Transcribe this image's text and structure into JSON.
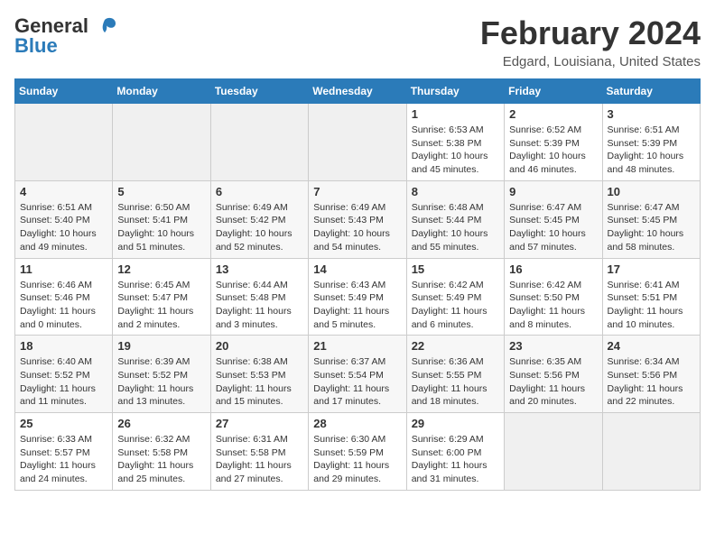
{
  "header": {
    "logo_general": "General",
    "logo_blue": "Blue",
    "month": "February 2024",
    "location": "Edgard, Louisiana, United States"
  },
  "days_of_week": [
    "Sunday",
    "Monday",
    "Tuesday",
    "Wednesday",
    "Thursday",
    "Friday",
    "Saturday"
  ],
  "weeks": [
    [
      {
        "day": "",
        "empty": true
      },
      {
        "day": "",
        "empty": true
      },
      {
        "day": "",
        "empty": true
      },
      {
        "day": "",
        "empty": true
      },
      {
        "day": "1",
        "sunrise": "Sunrise: 6:53 AM",
        "sunset": "Sunset: 5:38 PM",
        "daylight": "Daylight: 10 hours and 45 minutes."
      },
      {
        "day": "2",
        "sunrise": "Sunrise: 6:52 AM",
        "sunset": "Sunset: 5:39 PM",
        "daylight": "Daylight: 10 hours and 46 minutes."
      },
      {
        "day": "3",
        "sunrise": "Sunrise: 6:51 AM",
        "sunset": "Sunset: 5:39 PM",
        "daylight": "Daylight: 10 hours and 48 minutes."
      }
    ],
    [
      {
        "day": "4",
        "sunrise": "Sunrise: 6:51 AM",
        "sunset": "Sunset: 5:40 PM",
        "daylight": "Daylight: 10 hours and 49 minutes."
      },
      {
        "day": "5",
        "sunrise": "Sunrise: 6:50 AM",
        "sunset": "Sunset: 5:41 PM",
        "daylight": "Daylight: 10 hours and 51 minutes."
      },
      {
        "day": "6",
        "sunrise": "Sunrise: 6:49 AM",
        "sunset": "Sunset: 5:42 PM",
        "daylight": "Daylight: 10 hours and 52 minutes."
      },
      {
        "day": "7",
        "sunrise": "Sunrise: 6:49 AM",
        "sunset": "Sunset: 5:43 PM",
        "daylight": "Daylight: 10 hours and 54 minutes."
      },
      {
        "day": "8",
        "sunrise": "Sunrise: 6:48 AM",
        "sunset": "Sunset: 5:44 PM",
        "daylight": "Daylight: 10 hours and 55 minutes."
      },
      {
        "day": "9",
        "sunrise": "Sunrise: 6:47 AM",
        "sunset": "Sunset: 5:45 PM",
        "daylight": "Daylight: 10 hours and 57 minutes."
      },
      {
        "day": "10",
        "sunrise": "Sunrise: 6:47 AM",
        "sunset": "Sunset: 5:45 PM",
        "daylight": "Daylight: 10 hours and 58 minutes."
      }
    ],
    [
      {
        "day": "11",
        "sunrise": "Sunrise: 6:46 AM",
        "sunset": "Sunset: 5:46 PM",
        "daylight": "Daylight: 11 hours and 0 minutes."
      },
      {
        "day": "12",
        "sunrise": "Sunrise: 6:45 AM",
        "sunset": "Sunset: 5:47 PM",
        "daylight": "Daylight: 11 hours and 2 minutes."
      },
      {
        "day": "13",
        "sunrise": "Sunrise: 6:44 AM",
        "sunset": "Sunset: 5:48 PM",
        "daylight": "Daylight: 11 hours and 3 minutes."
      },
      {
        "day": "14",
        "sunrise": "Sunrise: 6:43 AM",
        "sunset": "Sunset: 5:49 PM",
        "daylight": "Daylight: 11 hours and 5 minutes."
      },
      {
        "day": "15",
        "sunrise": "Sunrise: 6:42 AM",
        "sunset": "Sunset: 5:49 PM",
        "daylight": "Daylight: 11 hours and 6 minutes."
      },
      {
        "day": "16",
        "sunrise": "Sunrise: 6:42 AM",
        "sunset": "Sunset: 5:50 PM",
        "daylight": "Daylight: 11 hours and 8 minutes."
      },
      {
        "day": "17",
        "sunrise": "Sunrise: 6:41 AM",
        "sunset": "Sunset: 5:51 PM",
        "daylight": "Daylight: 11 hours and 10 minutes."
      }
    ],
    [
      {
        "day": "18",
        "sunrise": "Sunrise: 6:40 AM",
        "sunset": "Sunset: 5:52 PM",
        "daylight": "Daylight: 11 hours and 11 minutes."
      },
      {
        "day": "19",
        "sunrise": "Sunrise: 6:39 AM",
        "sunset": "Sunset: 5:52 PM",
        "daylight": "Daylight: 11 hours and 13 minutes."
      },
      {
        "day": "20",
        "sunrise": "Sunrise: 6:38 AM",
        "sunset": "Sunset: 5:53 PM",
        "daylight": "Daylight: 11 hours and 15 minutes."
      },
      {
        "day": "21",
        "sunrise": "Sunrise: 6:37 AM",
        "sunset": "Sunset: 5:54 PM",
        "daylight": "Daylight: 11 hours and 17 minutes."
      },
      {
        "day": "22",
        "sunrise": "Sunrise: 6:36 AM",
        "sunset": "Sunset: 5:55 PM",
        "daylight": "Daylight: 11 hours and 18 minutes."
      },
      {
        "day": "23",
        "sunrise": "Sunrise: 6:35 AM",
        "sunset": "Sunset: 5:56 PM",
        "daylight": "Daylight: 11 hours and 20 minutes."
      },
      {
        "day": "24",
        "sunrise": "Sunrise: 6:34 AM",
        "sunset": "Sunset: 5:56 PM",
        "daylight": "Daylight: 11 hours and 22 minutes."
      }
    ],
    [
      {
        "day": "25",
        "sunrise": "Sunrise: 6:33 AM",
        "sunset": "Sunset: 5:57 PM",
        "daylight": "Daylight: 11 hours and 24 minutes."
      },
      {
        "day": "26",
        "sunrise": "Sunrise: 6:32 AM",
        "sunset": "Sunset: 5:58 PM",
        "daylight": "Daylight: 11 hours and 25 minutes."
      },
      {
        "day": "27",
        "sunrise": "Sunrise: 6:31 AM",
        "sunset": "Sunset: 5:58 PM",
        "daylight": "Daylight: 11 hours and 27 minutes."
      },
      {
        "day": "28",
        "sunrise": "Sunrise: 6:30 AM",
        "sunset": "Sunset: 5:59 PM",
        "daylight": "Daylight: 11 hours and 29 minutes."
      },
      {
        "day": "29",
        "sunrise": "Sunrise: 6:29 AM",
        "sunset": "Sunset: 6:00 PM",
        "daylight": "Daylight: 11 hours and 31 minutes."
      },
      {
        "day": "",
        "empty": true
      },
      {
        "day": "",
        "empty": true
      }
    ]
  ]
}
